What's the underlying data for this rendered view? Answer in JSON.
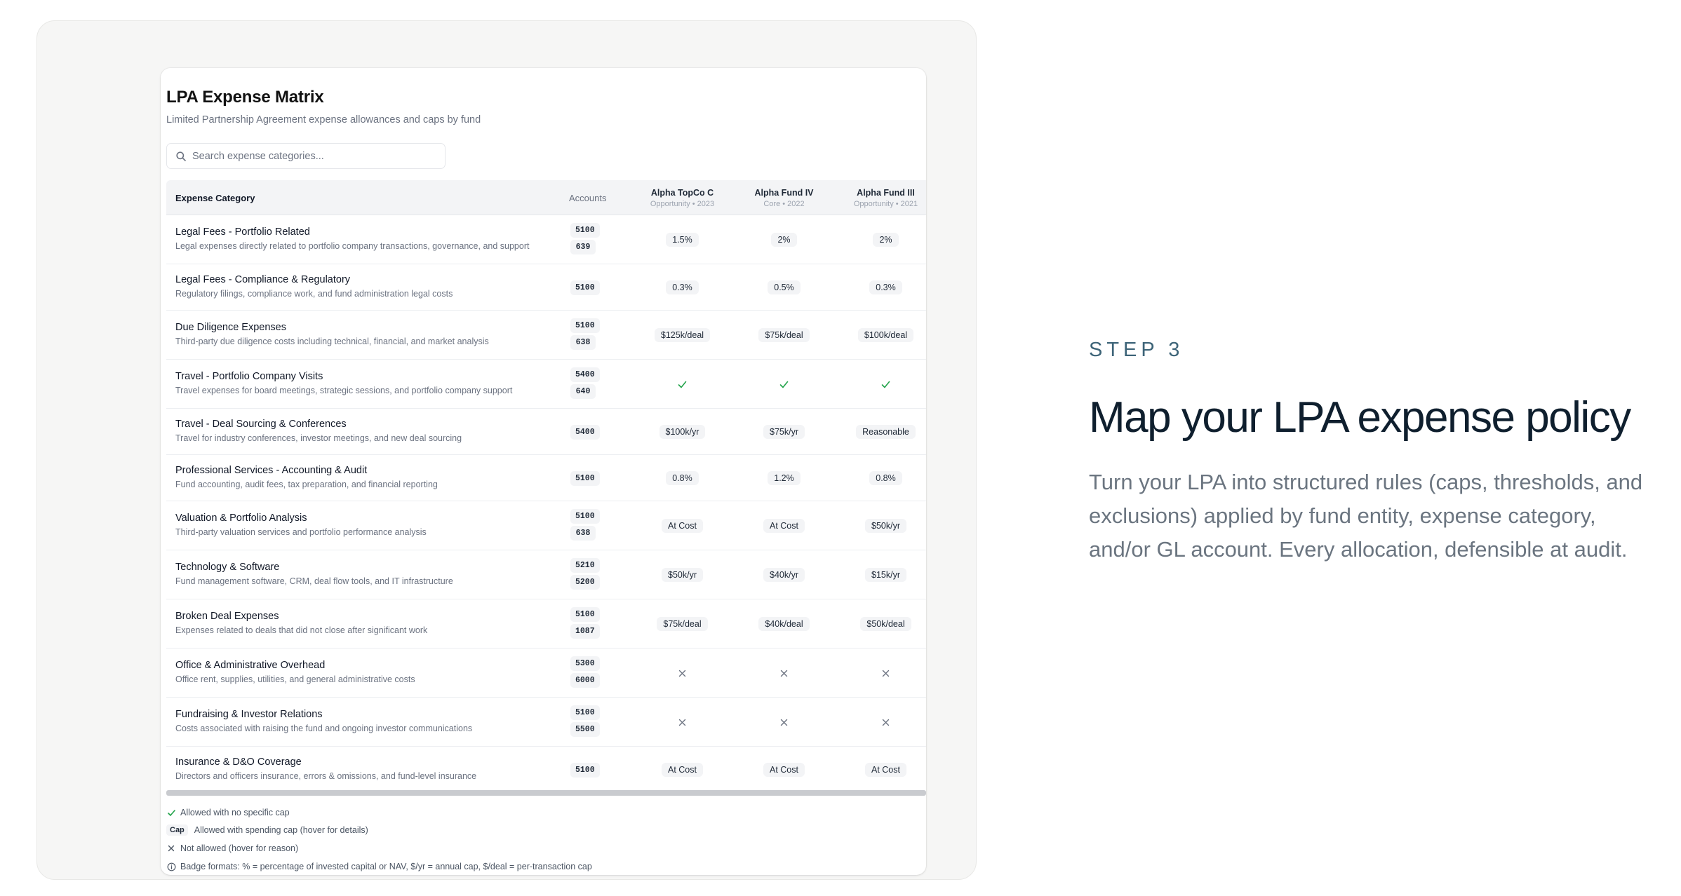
{
  "colors": {
    "accent_green": "#22a34a",
    "x_mark": "#6b7280",
    "step_label": "#3d6478",
    "headline": "#0f1f2e"
  },
  "matrix": {
    "title": "LPA Expense Matrix",
    "subtitle": "Limited Partnership Agreement expense allowances and caps by fund",
    "search": {
      "placeholder": "Search expense categories...",
      "value": "",
      "icon": "search-icon"
    },
    "columns": {
      "category": "Expense Category",
      "accounts": "Accounts",
      "funds": [
        {
          "name": "Alpha TopCo C",
          "meta": "Opportunity • 2023"
        },
        {
          "name": "Alpha Fund IV",
          "meta": "Core • 2022"
        },
        {
          "name": "Alpha Fund III",
          "meta": "Opportunity • 2021"
        }
      ]
    },
    "rows": [
      {
        "name": "Legal Fees - Portfolio Related",
        "desc": "Legal expenses directly related to portfolio company transactions, governance, and support",
        "accounts": [
          "5100",
          "639"
        ],
        "cells": [
          {
            "type": "cap",
            "text": "1.5%"
          },
          {
            "type": "cap",
            "text": "2%"
          },
          {
            "type": "cap",
            "text": "2%"
          }
        ]
      },
      {
        "name": "Legal Fees - Compliance & Regulatory",
        "desc": "Regulatory filings, compliance work, and fund administration legal costs",
        "accounts": [
          "5100"
        ],
        "cells": [
          {
            "type": "cap",
            "text": "0.3%"
          },
          {
            "type": "cap",
            "text": "0.5%"
          },
          {
            "type": "cap",
            "text": "0.3%"
          }
        ]
      },
      {
        "name": "Due Diligence Expenses",
        "desc": "Third-party due diligence costs including technical, financial, and market analysis",
        "accounts": [
          "5100",
          "638"
        ],
        "cells": [
          {
            "type": "cap",
            "text": "$125k/deal"
          },
          {
            "type": "cap",
            "text": "$75k/deal"
          },
          {
            "type": "cap",
            "text": "$100k/deal"
          }
        ]
      },
      {
        "name": "Travel - Portfolio Company Visits",
        "desc": "Travel expenses for board meetings, strategic sessions, and portfolio company support",
        "accounts": [
          "5400",
          "640"
        ],
        "cells": [
          {
            "type": "allowed"
          },
          {
            "type": "allowed"
          },
          {
            "type": "allowed"
          }
        ]
      },
      {
        "name": "Travel - Deal Sourcing & Conferences",
        "desc": "Travel for industry conferences, investor meetings, and new deal sourcing",
        "accounts": [
          "5400"
        ],
        "cells": [
          {
            "type": "cap",
            "text": "$100k/yr"
          },
          {
            "type": "cap",
            "text": "$75k/yr"
          },
          {
            "type": "cap",
            "text": "Reasonable"
          }
        ]
      },
      {
        "name": "Professional Services - Accounting & Audit",
        "desc": "Fund accounting, audit fees, tax preparation, and financial reporting",
        "accounts": [
          "5100"
        ],
        "cells": [
          {
            "type": "cap",
            "text": "0.8%"
          },
          {
            "type": "cap",
            "text": "1.2%"
          },
          {
            "type": "cap",
            "text": "0.8%"
          }
        ]
      },
      {
        "name": "Valuation & Portfolio Analysis",
        "desc": "Third-party valuation services and portfolio performance analysis",
        "accounts": [
          "5100",
          "638"
        ],
        "cells": [
          {
            "type": "cap",
            "text": "At Cost"
          },
          {
            "type": "cap",
            "text": "At Cost"
          },
          {
            "type": "cap",
            "text": "$50k/yr"
          }
        ]
      },
      {
        "name": "Technology & Software",
        "desc": "Fund management software, CRM, deal flow tools, and IT infrastructure",
        "accounts": [
          "5210",
          "5200"
        ],
        "cells": [
          {
            "type": "cap",
            "text": "$50k/yr"
          },
          {
            "type": "cap",
            "text": "$40k/yr"
          },
          {
            "type": "cap",
            "text": "$15k/yr"
          }
        ]
      },
      {
        "name": "Broken Deal Expenses",
        "desc": "Expenses related to deals that did not close after significant work",
        "accounts": [
          "5100",
          "1087"
        ],
        "cells": [
          {
            "type": "cap",
            "text": "$75k/deal"
          },
          {
            "type": "cap",
            "text": "$40k/deal"
          },
          {
            "type": "cap",
            "text": "$50k/deal"
          }
        ]
      },
      {
        "name": "Office & Administrative Overhead",
        "desc": "Office rent, supplies, utilities, and general administrative costs",
        "accounts": [
          "5300",
          "6000"
        ],
        "cells": [
          {
            "type": "not_allowed"
          },
          {
            "type": "not_allowed"
          },
          {
            "type": "not_allowed"
          }
        ]
      },
      {
        "name": "Fundraising & Investor Relations",
        "desc": "Costs associated with raising the fund and ongoing investor communications",
        "accounts": [
          "5100",
          "5500"
        ],
        "cells": [
          {
            "type": "not_allowed"
          },
          {
            "type": "not_allowed"
          },
          {
            "type": "not_allowed"
          }
        ]
      },
      {
        "name": "Insurance & D&O Coverage",
        "desc": "Directors and officers insurance, errors & omissions, and fund-level insurance",
        "accounts": [
          "5100"
        ],
        "cells": [
          {
            "type": "cap",
            "text": "At Cost"
          },
          {
            "type": "cap",
            "text": "At Cost"
          },
          {
            "type": "cap",
            "text": "At Cost"
          }
        ]
      }
    ],
    "legend": {
      "allowed": "Allowed with no specific cap",
      "cap_chip": "Cap",
      "cap": "Allowed with spending cap (hover for details)",
      "not_allowed": "Not allowed (hover for reason)",
      "formats": "Badge formats: % = percentage of invested capital or NAV, $/yr = annual cap, $/deal = per-transaction cap"
    }
  },
  "marketing": {
    "step": "STEP 3",
    "headline": "Map your LPA expense policy",
    "body": "Turn your LPA into structured rules (caps, thresholds, and exclusions) applied by fund entity, expense category, and/or GL account. Every allocation, defensible at audit."
  }
}
